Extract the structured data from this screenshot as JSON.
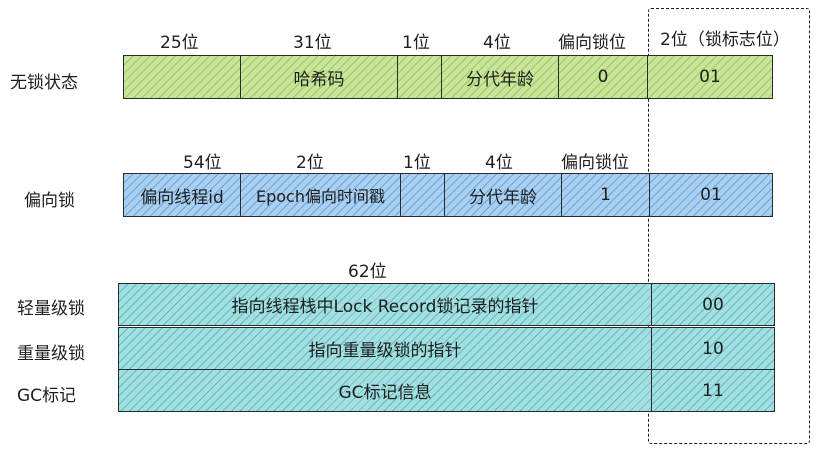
{
  "rows": {
    "unlocked": {
      "label": "无锁状态",
      "bits": [
        "25位",
        "31位",
        "1位",
        "4位",
        "偏向锁位",
        "2位（锁标志位）"
      ],
      "cells": [
        "",
        "哈希码",
        "",
        "分代年龄",
        "0",
        "01"
      ]
    },
    "biased": {
      "label": "偏向锁",
      "bits": [
        "54位",
        "2位",
        "1位",
        "4位",
        "偏向锁位"
      ],
      "cells": [
        "偏向线程id",
        "Epoch偏向时间戳",
        "",
        "分代年龄",
        "1",
        "01"
      ]
    },
    "header_62": "62位",
    "lightweight": {
      "label": "轻量级锁",
      "content": "指向线程栈中Lock Record锁记录的指针",
      "flag": "00"
    },
    "heavyweight": {
      "label": "重量级锁",
      "content": "指向重量级锁的指针",
      "flag": "10"
    },
    "gc": {
      "label": "GC标记",
      "content": "GC标记信息",
      "flag": "11"
    }
  },
  "colors": {
    "green": "#c8e59a",
    "blue": "#a9d0f1",
    "teal": "#a3dfe1"
  }
}
